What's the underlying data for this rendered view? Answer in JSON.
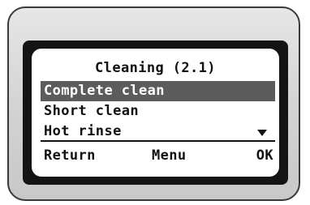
{
  "screen": {
    "title": "Cleaning (2.1)",
    "items": [
      {
        "label": "Complete clean",
        "selected": true
      },
      {
        "label": "Short clean",
        "selected": false
      },
      {
        "label": "Hot rinse",
        "selected": false
      }
    ],
    "scroll_indicator_icon": "triangle-down-icon"
  },
  "softkeys": {
    "return_label": "Return",
    "menu_label": "Menu",
    "ok_label": "OK"
  },
  "colors": {
    "selection": "#5c5c5c",
    "screen_background": "#ffffff",
    "bezel": "#141414",
    "housing": "#d2d2d2"
  }
}
